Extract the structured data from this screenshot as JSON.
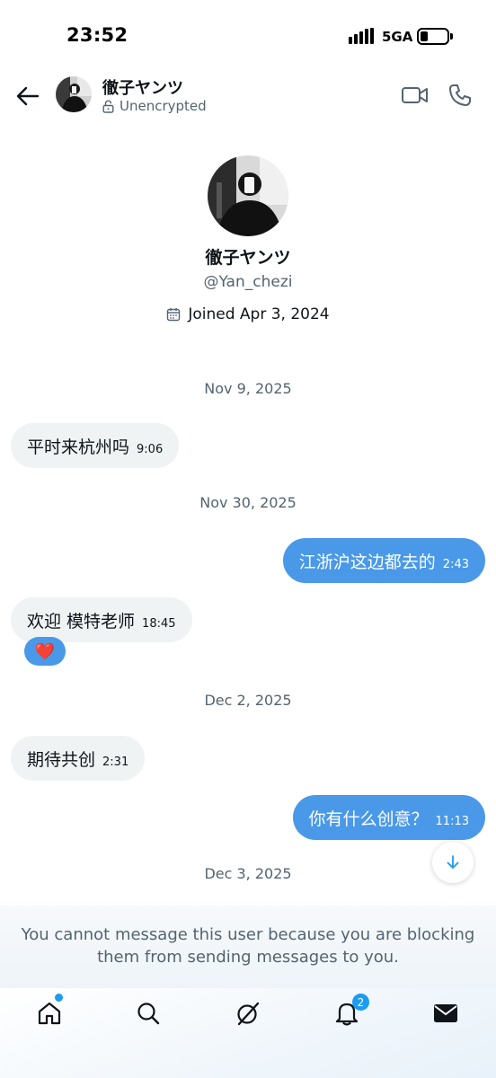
{
  "status_bar": {
    "time": "23:52",
    "network": "5GA"
  },
  "header": {
    "name": "徹子ヤンツ",
    "encryption": "Unencrypted"
  },
  "profile": {
    "name": "徹子ヤンツ",
    "handle": "@Yan_chezi",
    "joined": "Joined Apr 3, 2024"
  },
  "conversation": {
    "dates": [
      "Nov 9, 2025",
      "Nov 30, 2025",
      "Dec 2, 2025",
      "Dec 3, 2025"
    ],
    "messages": [
      {
        "direction": "incoming",
        "text": "平时来杭州吗",
        "time": "9:06"
      },
      {
        "direction": "outgoing",
        "text": "江浙沪这边都去的",
        "time": "2:43"
      },
      {
        "direction": "incoming",
        "text": "欢迎 模特老师",
        "time": "18:45",
        "reaction": "❤️"
      },
      {
        "direction": "incoming",
        "text": "期待共创",
        "time": "2:31"
      },
      {
        "direction": "outgoing",
        "text": "你有什么创意？",
        "time": "11:13"
      }
    ]
  },
  "notice": "You cannot message this user because you are blocking them from sending messages to you.",
  "tabbar": {
    "items": [
      "home-icon",
      "search-icon",
      "grok-icon",
      "notifications-icon",
      "messages-icon"
    ],
    "notifications_count": "2"
  },
  "colors": {
    "accent": "#1d9bf0",
    "outgoing_bubble": "#4a99e9",
    "incoming_bubble": "#eff3f4",
    "secondary_text": "#536471"
  }
}
